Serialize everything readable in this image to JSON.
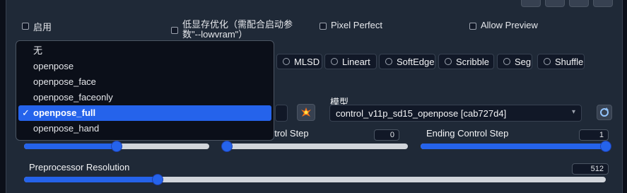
{
  "checkboxes": {
    "enable": "启用",
    "lowvram": "低显存优化（需配合启动参数\"--lowvram\"）",
    "pixel_perfect": "Pixel Perfect",
    "allow_preview": "Allow Preview"
  },
  "control_types": [
    "MLSD",
    "Lineart",
    "SoftEdge",
    "Scribble",
    "Seg",
    "Shuffle"
  ],
  "preprocessor_dropdown": {
    "options": [
      "无",
      "openpose",
      "openpose_face",
      "openpose_faceonly",
      "openpose_full",
      "openpose_hand"
    ],
    "selected": "openpose_full",
    "check": "✓"
  },
  "model": {
    "label": "模型",
    "value": "control_v11p_sd15_openpose [cab727d4]"
  },
  "sliders": {
    "control_weight": {
      "level": 0.5
    },
    "starting_step": {
      "label_partial": "ntrol Step",
      "value": "0",
      "level": 0.0
    },
    "ending_step": {
      "label": "Ending Control Step",
      "value": "1",
      "level": 1.0
    },
    "preprocessor_resolution": {
      "label": "Preprocessor Resolution",
      "value": "512",
      "level": 0.23
    }
  },
  "colors": {
    "accent": "#2563eb",
    "panel": "#1f2937",
    "background": "#0b0f19"
  },
  "icons": {
    "fire": "fire-icon",
    "refresh": "refresh-icon",
    "caret": "chevron-down-icon"
  }
}
